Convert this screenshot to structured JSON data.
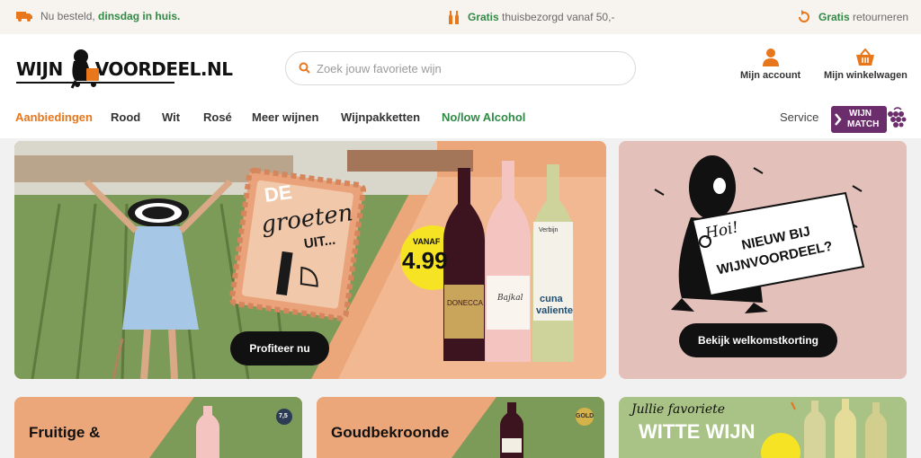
{
  "topbar": {
    "delivery_prefix": "Nu besteld, ",
    "delivery_highlight": "dinsdag in huis.",
    "shipping_highlight": "Gratis",
    "shipping_text": " thuisbezorgd vanaf 50,-",
    "returns_highlight": "Gratis",
    "returns_text": " retourneren"
  },
  "header": {
    "logo_left": "WIJN",
    "logo_right": "VOORDEEL.NL",
    "search_placeholder": "Zoek jouw favoriete wijn",
    "account_label": "Mijn account",
    "cart_label": "Mijn winkelwagen"
  },
  "nav": {
    "items": [
      "Aanbiedingen",
      "Rood",
      "Wit",
      "Rosé",
      "Meer wijnen",
      "Wijnpakketten",
      "No/low Alcohol"
    ],
    "service": "Service",
    "match_line1": "WIJN",
    "match_line2": "MATCH"
  },
  "hero": {
    "stamp_line1": "DE",
    "stamp_line2": "groeten",
    "stamp_line3": "UIT...",
    "price_prefix": "VANAF",
    "price": "4.99",
    "bottle1": "DONECCA",
    "bottle2": "Bajkal",
    "bottle3_line1": "cuna",
    "bottle3_line2": "valiente",
    "bottle3_brand": "Verbijn",
    "cta": "Profiteer nu"
  },
  "side": {
    "sign_line1": "Hoi!",
    "sign_line2": "NIEUW BIJ",
    "sign_line3": "WIJNVOORDEEL?",
    "cta": "Bekijk welkomstkorting"
  },
  "cards": [
    {
      "title": "Fruitige &",
      "badge": "7,5"
    },
    {
      "title": "Goudbekroonde",
      "badge": "GOLD"
    },
    {
      "script": "Jullie favoriete",
      "headline": "WITTE WIJN"
    }
  ],
  "colors": {
    "accent_orange": "#e8761b",
    "green": "#2f8a45",
    "purple": "#6b2d6b",
    "dark": "#111111",
    "hero_peach": "#eba77a",
    "side_pink": "#e4c0ba"
  }
}
